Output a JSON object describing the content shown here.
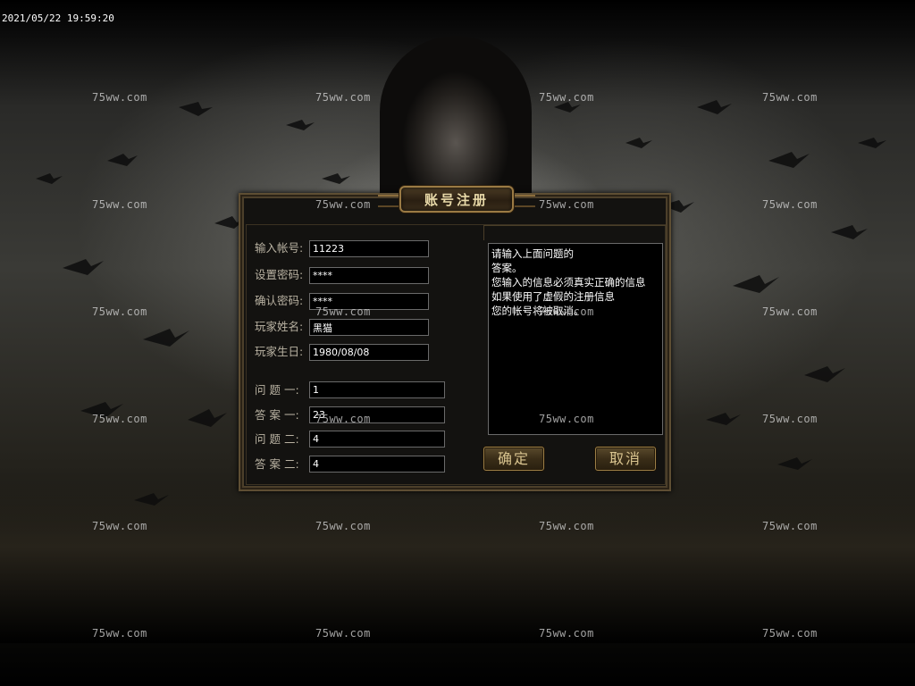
{
  "timestamp": "2021/05/22 19:59:20",
  "watermark": "75ww.com",
  "dialog": {
    "title": "账号注册",
    "fields": [
      {
        "label": "输入帐号:",
        "value": "11223"
      },
      {
        "label": "设置密码:",
        "value": "****"
      },
      {
        "label": "确认密码:",
        "value": "****"
      },
      {
        "label": "玩家姓名:",
        "value": "黑猫"
      },
      {
        "label": "玩家生日:",
        "value": "1980/08/08"
      }
    ],
    "questions": [
      {
        "label": "问 题 一:",
        "value": "1"
      },
      {
        "label": "答 案 一:",
        "value": "23"
      },
      {
        "label": "问 题 二:",
        "value": "4"
      },
      {
        "label": "答 案 二:",
        "value": "4"
      }
    ],
    "info_lines": [
      "请输入上面问题的",
      "答案。",
      "您输入的信息必须真实正确的信息",
      "如果使用了虚假的注册信息",
      "您的帐号将被取消。"
    ],
    "confirm_label": "确定",
    "cancel_label": "取消"
  },
  "colors": {
    "frame": "#5e4e33",
    "gold_text": "#d9c48f",
    "label_text": "#b9b2a2"
  }
}
